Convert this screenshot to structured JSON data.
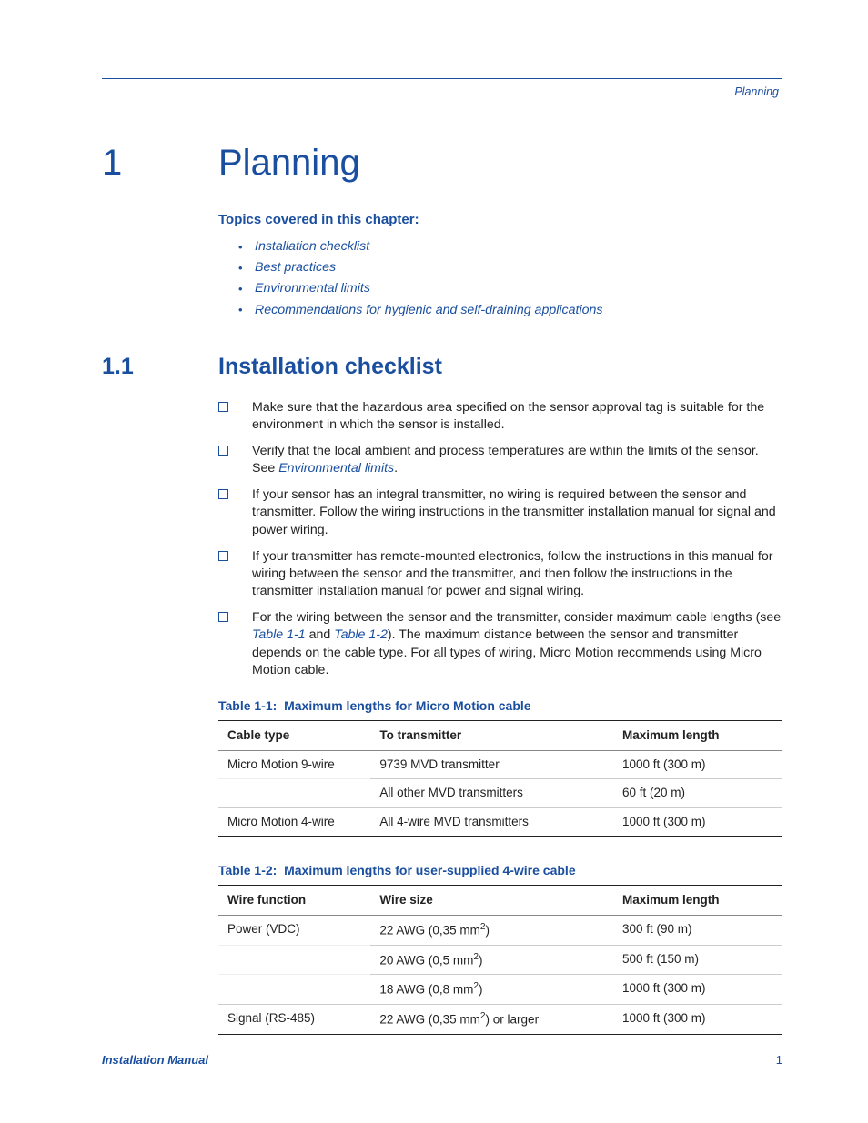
{
  "running_head": "Planning",
  "chapter": {
    "number": "1",
    "title": "Planning"
  },
  "topics_heading": "Topics covered in this chapter:",
  "topics": [
    "Installation checklist",
    "Best practices",
    "Environmental limits",
    "Recommendations for hygienic and self-draining applications"
  ],
  "section": {
    "number": "1.1",
    "title": "Installation checklist"
  },
  "checklist": {
    "items": [
      "Make sure that the hazardous area specified on the sensor approval tag is suitable for the environment in which the sensor is installed.",
      {
        "pre": "Verify that the local ambient and process temperatures are within the limits of the sensor. See ",
        "link": "Environmental limits",
        "post": "."
      },
      "If your sensor has an integral transmitter, no wiring is required between the sensor and transmitter. Follow the wiring instructions in the transmitter installation manual for signal and power wiring.",
      "If your transmitter has remote-mounted electronics, follow the instructions in this manual for wiring between the sensor and the transmitter, and then follow the instructions in the transmitter installation manual for power and signal wiring.",
      {
        "pre": "For the wiring between the sensor and the transmitter, consider maximum cable lengths (see ",
        "link1": "Table 1-1",
        "mid": " and ",
        "link2": "Table 1-2",
        "post": "). The maximum distance between the sensor and transmitter depends on the cable type. For all types of wiring, Micro Motion recommends using Micro Motion cable."
      }
    ]
  },
  "table1": {
    "caption_label": "Table 1-1:",
    "caption_text": "Maximum lengths for Micro Motion cable",
    "headers": [
      "Cable type",
      "To transmitter",
      "Maximum length"
    ],
    "rows": [
      [
        "Micro Motion 9-wire",
        "9739 MVD transmitter",
        "1000 ft (300 m)"
      ],
      [
        "",
        "All other MVD transmitters",
        "60 ft (20 m)"
      ],
      [
        "Micro Motion 4-wire",
        "All 4-wire MVD transmitters",
        "1000 ft (300 m)"
      ]
    ]
  },
  "table2": {
    "caption_label": "Table 1-2:",
    "caption_text": "Maximum lengths for user-supplied 4-wire cable",
    "headers": [
      "Wire function",
      "Wire size",
      "Maximum length"
    ],
    "rows": [
      {
        "c0": "Power (VDC)",
        "c1_pre": "22 AWG (0,35 mm",
        "c1_sup": "2",
        "c1_post": ")",
        "c2": "300 ft (90 m)"
      },
      {
        "c0": "",
        "c1_pre": "20 AWG (0,5 mm",
        "c1_sup": "2",
        "c1_post": ")",
        "c2": "500 ft (150 m)"
      },
      {
        "c0": "",
        "c1_pre": "18 AWG (0,8 mm",
        "c1_sup": "2",
        "c1_post": ")",
        "c2": "1000 ft (300 m)"
      },
      {
        "c0": "Signal (RS-485)",
        "c1_pre": "22 AWG (0,35 mm",
        "c1_sup": "2",
        "c1_post": ") or larger",
        "c2": "1000 ft (300 m)"
      }
    ]
  },
  "footer": {
    "left": "Installation Manual",
    "right": "1"
  }
}
